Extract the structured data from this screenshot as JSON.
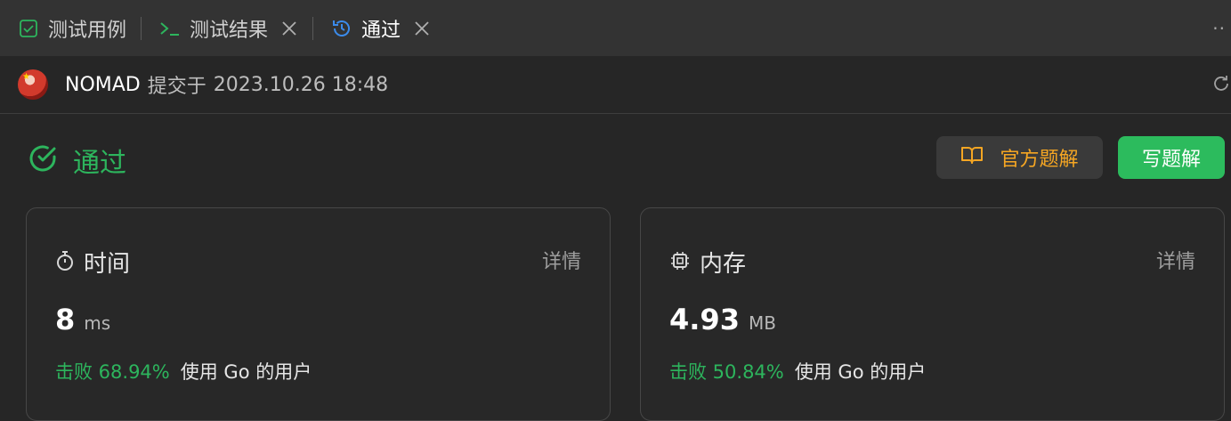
{
  "tabs": [
    {
      "label": "测试用例",
      "icon": "checkbox-icon",
      "active": false
    },
    {
      "label": "测试结果",
      "icon": "terminal-icon",
      "active": false,
      "closable": true
    },
    {
      "label": "通过",
      "icon": "history-icon",
      "active": true,
      "closable": true
    }
  ],
  "more_label": "··",
  "submission": {
    "user": "NOMAD",
    "verb": "提交于",
    "time": "2023.10.26 18:48"
  },
  "status": {
    "label": "通过",
    "color": "#2db55d"
  },
  "buttons": {
    "official_solution": "官方题解",
    "write_solution": "写题解"
  },
  "cards": {
    "time": {
      "title": "时间",
      "detail": "详情",
      "value": "8",
      "unit": "ms",
      "beat_prefix": "击败 68.94%",
      "beat_suffix": "使用 Go 的用户"
    },
    "memory": {
      "title": "内存",
      "detail": "详情",
      "value": "4.93",
      "unit": "MB",
      "beat_prefix": "击败 50.84%",
      "beat_suffix": "使用 Go 的用户"
    }
  },
  "colors": {
    "accent_green": "#2cbb5d",
    "accent_orange": "#f5a623",
    "active_tab_icon": "#3b8beb"
  }
}
